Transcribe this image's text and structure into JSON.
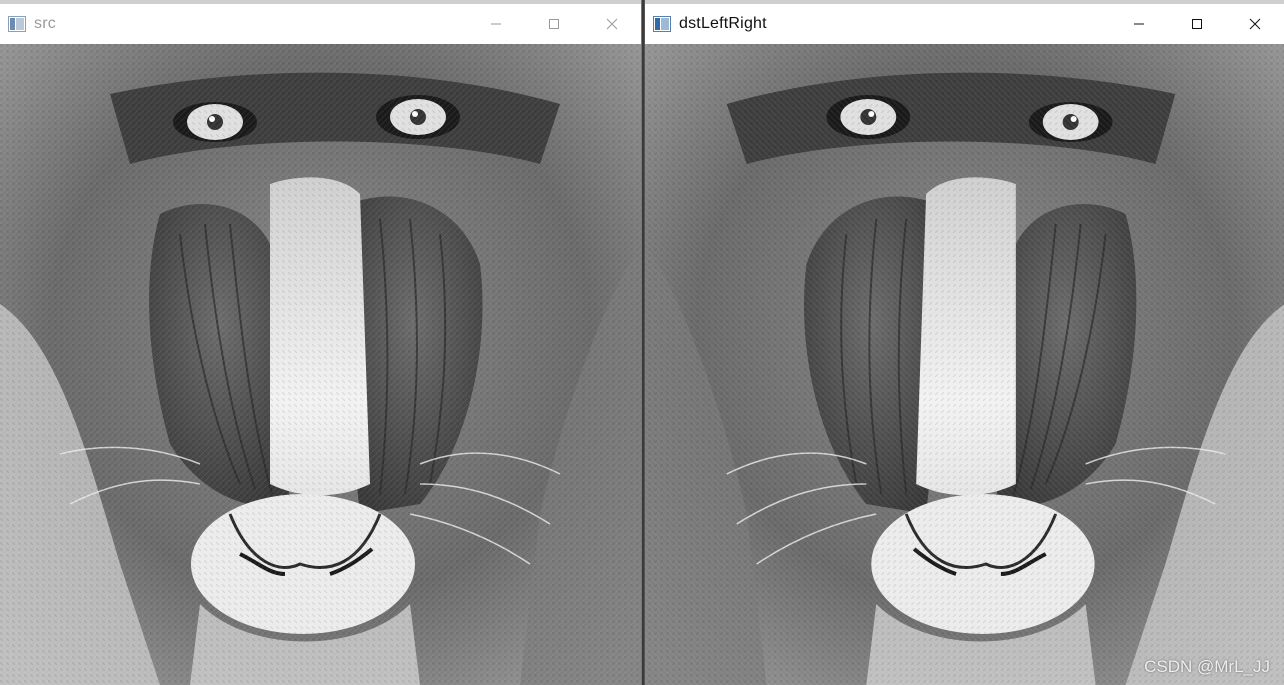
{
  "windows": {
    "left": {
      "title": "src",
      "image_alt": "mandrill baboon grayscale"
    },
    "right": {
      "title": "dstLeftRight",
      "image_alt": "mandrill baboon grayscale, horizontally flipped"
    }
  },
  "icons": {
    "app": "app-window-icon",
    "minimize": "minimize-icon",
    "maximize": "maximize-icon",
    "close": "close-icon"
  },
  "watermark": "CSDN @MrL_JJ"
}
